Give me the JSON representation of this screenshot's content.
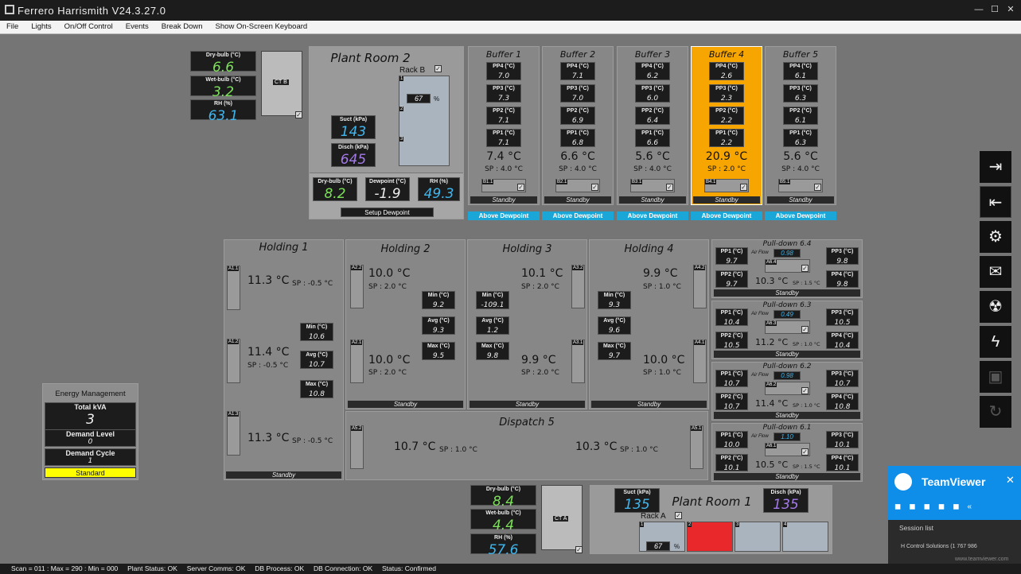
{
  "window": {
    "title": "Ferrero Harrismith V24.3.27.0",
    "min": "—",
    "max": "☐",
    "close": "✕"
  },
  "menu": [
    "File",
    "Lights",
    "On/Off Control",
    "Events",
    "Break Down",
    "Show On-Screen Keyboard"
  ],
  "ctb": {
    "label": "CT B",
    "dry_label": "Dry-bulb (°C)",
    "dry": "6.6",
    "wet_label": "Wet-bulb (°C)",
    "wet": "3.2",
    "rh_label": "RH (%)",
    "rh": "63.1"
  },
  "cta": {
    "label": "CT A",
    "dry_label": "Dry-bulb (°C)",
    "dry": "8.4",
    "wet_label": "Wet-bulb (°C)",
    "wet": "4.4",
    "rh_label": "RH (%)",
    "rh": "57.6"
  },
  "plant2": {
    "title": "Plant Room 2",
    "rack": "Rack B",
    "suct_label": "Suct (kPa)",
    "suct": "143",
    "disch_label": "Disch (kPa)",
    "disch": "645",
    "pct": "67",
    "pct_unit": "%",
    "n1": "1",
    "n2": "2",
    "n3": "3",
    "dew_dry_label": "Dry-bulb (°C)",
    "dew_dry": "8.2",
    "dew_label": "Dewpoint (°C)",
    "dew": "-1.9",
    "dew_rh_label": "RH (%)",
    "dew_rh": "49.3",
    "setup": "Setup Dewpoint"
  },
  "buffers": [
    {
      "title": "Buffer 1",
      "pp4": "7.0",
      "pp3": "7.3",
      "pp2": "7.1",
      "pp1": "7.1",
      "temp": "7.4 °C",
      "sp": "SP : 4.0 °C",
      "tag": "B1.1",
      "status": "Standby",
      "alert": "Above Dewpoint"
    },
    {
      "title": "Buffer 2",
      "pp4": "7.1",
      "pp3": "7.0",
      "pp2": "6.9",
      "pp1": "6.8",
      "temp": "6.6 °C",
      "sp": "SP : 4.0 °C",
      "tag": "B2.1",
      "status": "Standby",
      "alert": "Above Dewpoint"
    },
    {
      "title": "Buffer 3",
      "pp4": "6.2",
      "pp3": "6.0",
      "pp2": "6.4",
      "pp1": "6.6",
      "temp": "5.6 °C",
      "sp": "SP : 4.0 °C",
      "tag": "B3.1",
      "status": "Standby",
      "alert": "Above Dewpoint"
    },
    {
      "title": "Buffer 4",
      "pp4": "2.6",
      "pp3": "2.3",
      "pp2": "2.2",
      "pp1": "2.2",
      "temp": "20.9 °C",
      "sp": "SP : 2.0 °C",
      "tag": "B4.1",
      "status": "Standby",
      "alert": "Above Dewpoint"
    },
    {
      "title": "Buffer 5",
      "pp4": "6.1",
      "pp3": "6.3",
      "pp2": "6.1",
      "pp1": "6.3",
      "temp": "5.6 °C",
      "sp": "SP : 4.0 °C",
      "tag": "B5.1",
      "status": "Standby",
      "alert": "Above Dewpoint"
    }
  ],
  "pp_labels": {
    "pp4": "PP4 (°C)",
    "pp3": "PP3 (°C)",
    "pp2": "PP2 (°C)",
    "pp1": "PP1 (°C)"
  },
  "holding1": {
    "title": "Holding 1",
    "t1": "11.3 °C",
    "sp1": "SP : -0.5 °C",
    "t2": "11.4 °C",
    "sp2": "SP : -0.5 °C",
    "t3": "11.3 °C",
    "sp3": "SP : -0.5 °C",
    "min_label": "Min (°C)",
    "min": "10.6",
    "avg_label": "Avg (°C)",
    "avg": "10.7",
    "max_label": "Max (°C)",
    "max": "10.8",
    "tag1": "A1.1",
    "tag2": "A1.2",
    "tag3": "A1.3",
    "status": "Standby"
  },
  "holding2": {
    "title": "Holding 2",
    "t1": "10.0 °C",
    "sp1": "SP : 2.0 °C",
    "t2": "10.0 °C",
    "sp2": "SP : 2.0 °C",
    "min_label": "Min (°C)",
    "min": "9.2",
    "avg_label": "Avg (°C)",
    "avg": "9.3",
    "max_label": "Max (°C)",
    "max": "9.5",
    "tag1": "A2.2",
    "tag2": "A2.1",
    "status": "Standby"
  },
  "holding3": {
    "title": "Holding 3",
    "t1": "10.1 °C",
    "sp1": "SP : 2.0 °C",
    "t2": "9.9 °C",
    "sp2": "SP : 2.0 °C",
    "min_label": "Min (°C)",
    "min": "-109.1",
    "avg_label": "Avg (°C)",
    "avg": "1.2",
    "max_label": "Max (°C)",
    "max": "9.8",
    "tag1": "A3.2",
    "tag2": "A3.1",
    "status": "Standby"
  },
  "holding4": {
    "title": "Holding 4",
    "t1": "9.9 °C",
    "sp1": "SP : 1.0 °C",
    "t2": "10.0 °C",
    "sp2": "SP : 1.0 °C",
    "min_label": "Min (°C)",
    "min": "9.3",
    "avg_label": "Avg (°C)",
    "avg": "9.6",
    "max_label": "Max (°C)",
    "max": "9.7",
    "tag1": "A4.2",
    "tag2": "A4.1",
    "status": "Standby"
  },
  "dispatch": {
    "title": "Dispatch 5",
    "t1": "10.7 °C",
    "sp1": "SP : 1.0 °C",
    "t2": "10.3 °C",
    "sp2": "SP : 1.0 °C",
    "tag1": "A5.2",
    "tag2": "A5.1"
  },
  "pulldowns": [
    {
      "title": "Pull-down 6.4",
      "pp1": "9.7",
      "pp2": "9.7",
      "pp3": "9.8",
      "pp4": "9.8",
      "air": "0.98",
      "tag": "A6.4",
      "temp": "10.3 °C",
      "sp": "SP : 1.5 °C",
      "status": "Standby"
    },
    {
      "title": "Pull-down 6.3",
      "pp1": "10.4",
      "pp2": "10.5",
      "pp3": "10.5",
      "pp4": "10.4",
      "air": "0.49",
      "tag": "A6.3",
      "temp": "11.2 °C",
      "sp": "SP : 1.0 °C",
      "status": "Standby"
    },
    {
      "title": "Pull-down 6.2",
      "pp1": "10.7",
      "pp2": "10.7",
      "pp3": "10.7",
      "pp4": "10.8",
      "air": "0.98",
      "tag": "A6.2",
      "temp": "11.4 °C",
      "sp": "SP : 1.0 °C",
      "status": "Standby"
    },
    {
      "title": "Pull-down 6.1",
      "pp1": "10.0",
      "pp2": "10.1",
      "pp3": "10.1",
      "pp4": "10.1",
      "air": "1.10",
      "tag": "A6.1",
      "temp": "10.5 °C",
      "sp": "SP : 1.5 °C",
      "status": "Standby"
    }
  ],
  "pd_labels": {
    "pp1": "PP1 (°C)",
    "pp2": "PP2 (°C)",
    "pp3": "PP3 (°C)",
    "pp4": "PP4 (°C)",
    "air": "Air Flow"
  },
  "energy": {
    "title": "Energy Management",
    "kva_label": "Total kVA",
    "kva": "3",
    "demand_label": "Demand Level",
    "demand": "0",
    "cycle_label": "Demand Cycle",
    "cycle": "1",
    "mode": "Standard"
  },
  "plant1": {
    "title": "Plant Room 1",
    "rack": "Rack A",
    "suct_label": "Suct (kPa)",
    "suct": "135",
    "disch_label": "Disch (kPa)",
    "disch": "135",
    "pct": "67",
    "pct_unit": "%",
    "n1": "1",
    "n2": "2",
    "n3": "3",
    "n4": "4"
  },
  "sidebar": [
    "login-icon",
    "logout-icon",
    "users-icon",
    "mail-icon",
    "alarm-icon",
    "power-icon",
    "save-icon",
    "refresh-icon"
  ],
  "teamviewer": {
    "title": "TeamViewer",
    "session": "Session list",
    "entry": "H Control Solutions (1 767 986",
    "url": "www.teamviewer.com"
  },
  "status": {
    "scan": "Scan = 011 : Max = 290 : Min = 000",
    "plant": "Plant Status: OK",
    "server": "Server Comms: OK",
    "db": "DB Process:  OK",
    "dbc": "DB Connection:  OK",
    "st": "Status:  Confirmed"
  },
  "colors": {
    "alarm": "#f7a500",
    "alert": "#1aa7d8",
    "standard": "#ffff00",
    "rack_fault": "#e8282a"
  }
}
